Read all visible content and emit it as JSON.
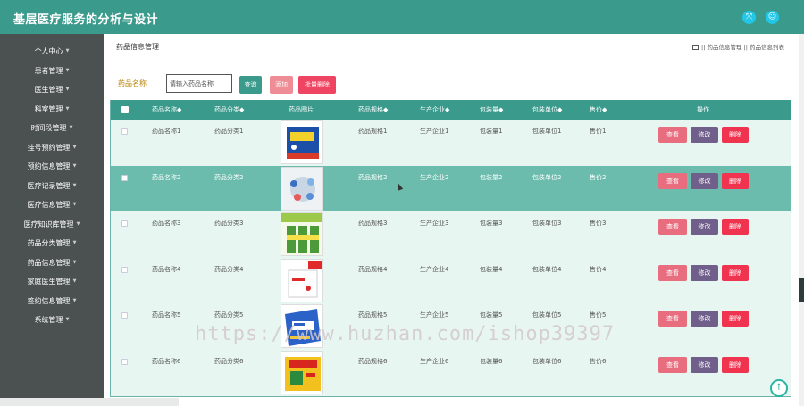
{
  "app": {
    "title": "基层医疗服务的分析与设计"
  },
  "header": {
    "icons": [
      "fullscreen-icon",
      "user-icon"
    ]
  },
  "sidebar": {
    "items": [
      {
        "label": "个人中心"
      },
      {
        "label": "患者管理"
      },
      {
        "label": "医生管理"
      },
      {
        "label": "科室管理"
      },
      {
        "label": "时间段管理"
      },
      {
        "label": "挂号预约管理"
      },
      {
        "label": "预约信息管理"
      },
      {
        "label": "医疗记录管理"
      },
      {
        "label": "医疗信息管理"
      },
      {
        "label": "医疗知识库管理"
      },
      {
        "label": "药品分类管理"
      },
      {
        "label": "药品信息管理"
      },
      {
        "label": "家庭医生管理"
      },
      {
        "label": "签约信息管理"
      },
      {
        "label": "系统管理"
      }
    ]
  },
  "page": {
    "title": "药品信息管理",
    "breadcrumb": "|| 药品信息管理 || 药品信息列表"
  },
  "search": {
    "label": "药品名称",
    "placeholder": "请输入药品名称",
    "search_btn": "查询",
    "add_btn": "添加",
    "batch_delete_btn": "批量删除"
  },
  "table": {
    "headers": [
      "药品名称◆",
      "药品分类◆",
      "药品图片",
      "药品规格◆",
      "生产企业◆",
      "包装量◆",
      "包装单位◆",
      "售价◆",
      "操作"
    ],
    "rows": [
      {
        "name": "药品名称1",
        "category": "药品分类1",
        "spec": "药品规格1",
        "maker": "生产企业1",
        "qty": "包装量1",
        "unit": "包装单位1",
        "price": "售价1"
      },
      {
        "name": "药品名称2",
        "category": "药品分类2",
        "spec": "药品规格2",
        "maker": "生产企业2",
        "qty": "包装量2",
        "unit": "包装单位2",
        "price": "售价2"
      },
      {
        "name": "药品名称3",
        "category": "药品分类3",
        "spec": "药品规格3",
        "maker": "生产企业3",
        "qty": "包装量3",
        "unit": "包装单位3",
        "price": "售价3"
      },
      {
        "name": "药品名称4",
        "category": "药品分类4",
        "spec": "药品规格4",
        "maker": "生产企业4",
        "qty": "包装量4",
        "unit": "包装单位4",
        "price": "售价4"
      },
      {
        "name": "药品名称5",
        "category": "药品分类5",
        "spec": "药品规格5",
        "maker": "生产企业5",
        "qty": "包装量5",
        "unit": "包装单位5",
        "price": "售价5"
      },
      {
        "name": "药品名称6",
        "category": "药品分类6",
        "spec": "药品规格6",
        "maker": "生产企业6",
        "qty": "包装量6",
        "unit": "包装单位6",
        "price": "售价6"
      }
    ],
    "actions": {
      "view": "查看",
      "edit": "修改",
      "delete": "删除"
    }
  },
  "watermark": "https://www.huzhan.com/ishop39397",
  "colors": {
    "primary": "#3a9a8c",
    "sidebar": "#4b5151",
    "highlight_row": "#6cbcad",
    "delete": "#f0344f",
    "edit": "#6f5f8a",
    "view": "#e86d7e"
  }
}
